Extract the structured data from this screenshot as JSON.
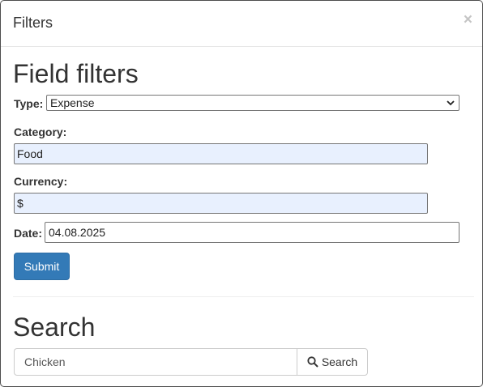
{
  "modal": {
    "title": "Filters",
    "close_glyph": "×"
  },
  "field_filters": {
    "heading": "Field filters",
    "type": {
      "label": "Type:",
      "selected": "Expense"
    },
    "category": {
      "label": "Category:",
      "value": "Food"
    },
    "currency": {
      "label": "Currency:",
      "value": "$"
    },
    "date": {
      "label": "Date:",
      "value": "04.08.2025"
    },
    "submit_label": "Submit"
  },
  "search": {
    "heading": "Search",
    "input_value": "Chicken",
    "button_label": "Search",
    "button_icon": "magnifier-icon"
  },
  "colors": {
    "primary": "#337ab7",
    "autofill": "#e8f0fe"
  }
}
